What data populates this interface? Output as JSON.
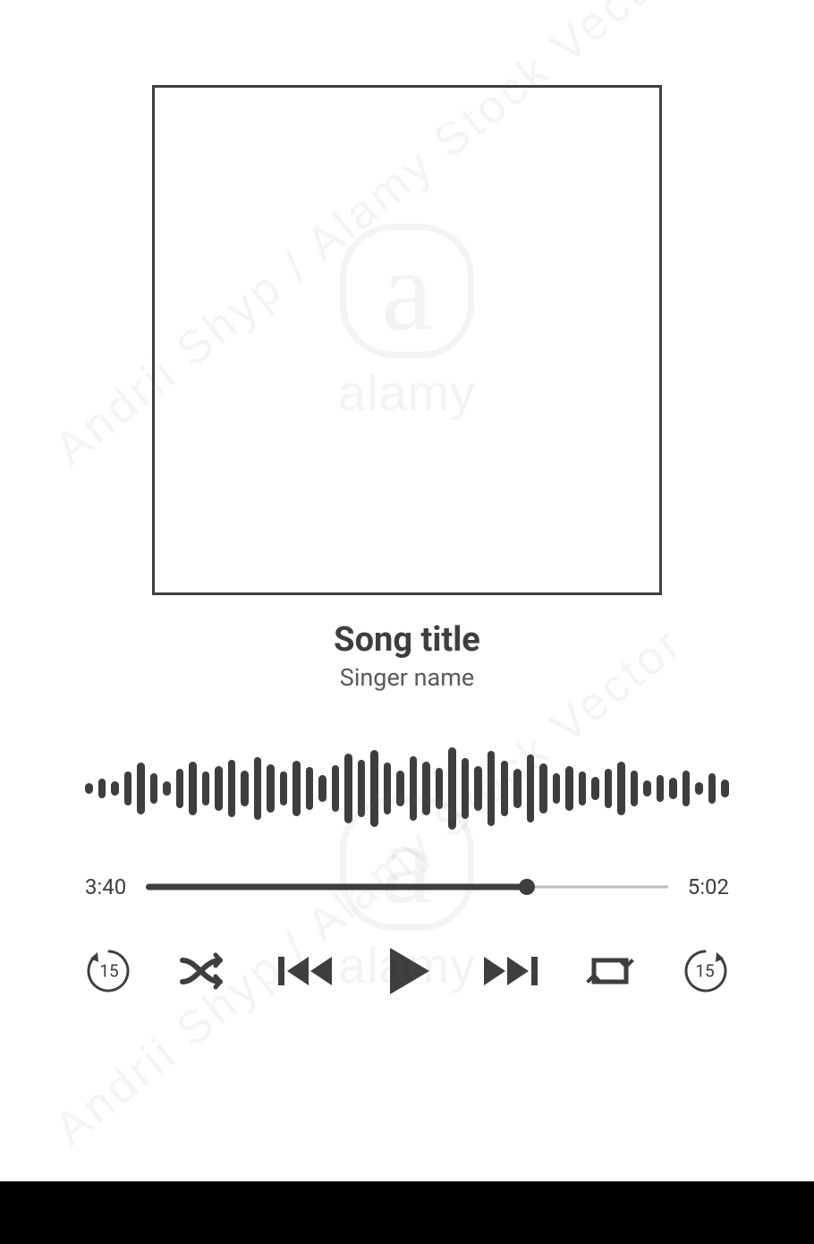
{
  "album_art": {},
  "song": {
    "title": "Song title",
    "artist": "Singer name"
  },
  "waveform": {
    "bars": [
      12,
      22,
      16,
      38,
      58,
      34,
      16,
      44,
      60,
      38,
      50,
      64,
      40,
      70,
      54,
      38,
      62,
      48,
      30,
      52,
      78,
      64,
      86,
      58,
      40,
      72,
      60,
      46,
      92,
      68,
      50,
      84,
      62,
      44,
      76,
      56,
      34,
      50,
      38,
      26,
      44,
      60,
      40,
      18,
      30,
      24,
      40,
      14,
      34,
      20
    ]
  },
  "progress": {
    "elapsed": "3:40",
    "total": "5:02",
    "percent": 73
  },
  "controls": {
    "skip_back_seconds": "15",
    "skip_forward_seconds": "15"
  },
  "watermark": {
    "diag1": "Andrii Shyp / Alamy Stock Vector",
    "diag2": "Andrii Shyp / Alamy Stock Vector",
    "logo_text": "alamy"
  }
}
